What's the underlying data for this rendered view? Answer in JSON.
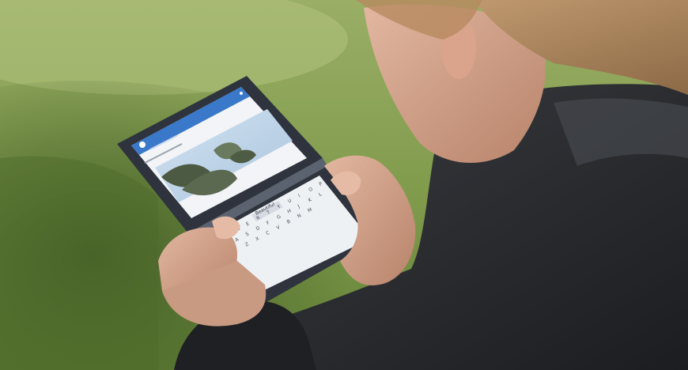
{
  "scene": {
    "subject": "person holding dual-screen device over grass",
    "colors": {
      "grass_light": "#8fa55a",
      "grass_dark": "#4f6a2c",
      "shadow": "#3d5524",
      "jacket": "#2a2b2e",
      "skin": "#c99a82",
      "hair": "#b48a5e",
      "device_frame": "#2f3440",
      "screen": "#f3f5f8",
      "app_header": "#3a78c9",
      "photo_sky": "#b9d1e6",
      "photo_leaf": "#4e5a44"
    },
    "icons": {
      "avatar": "avatar-icon",
      "menu": "menu-icon"
    }
  },
  "top_screen": {
    "app_title": "",
    "post_text": ""
  },
  "bottom_screen": {
    "keyboard_rows": [
      [
        "Q",
        "W",
        "E",
        "R",
        "T",
        "Y",
        "U",
        "I",
        "O",
        "P"
      ],
      [
        "A",
        "S",
        "D",
        "F",
        "G",
        "H",
        "J",
        "K",
        "L"
      ],
      [
        "Z",
        "X",
        "C",
        "V",
        "B",
        "N",
        "M"
      ]
    ],
    "suggestion": "Beautiful"
  }
}
